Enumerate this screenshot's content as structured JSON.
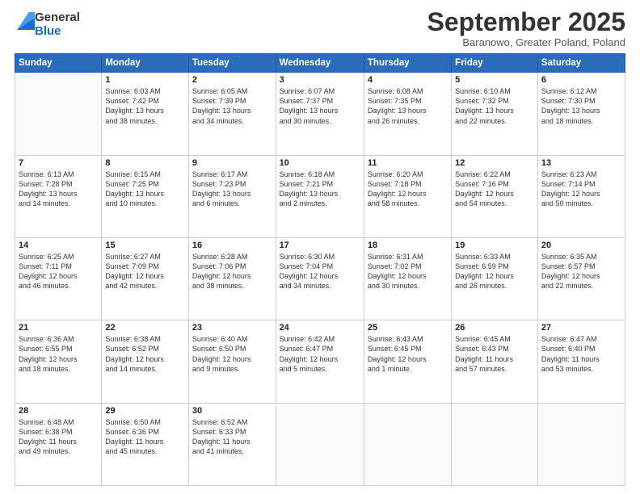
{
  "logo": {
    "general": "General",
    "blue": "Blue"
  },
  "header": {
    "month": "September 2025",
    "subtitle": "Baranowo, Greater Poland, Poland"
  },
  "weekdays": [
    "Sunday",
    "Monday",
    "Tuesday",
    "Wednesday",
    "Thursday",
    "Friday",
    "Saturday"
  ],
  "weeks": [
    [
      {
        "day": "",
        "info": ""
      },
      {
        "day": "1",
        "info": "Sunrise: 6:03 AM\nSunset: 7:42 PM\nDaylight: 13 hours\nand 38 minutes."
      },
      {
        "day": "2",
        "info": "Sunrise: 6:05 AM\nSunset: 7:39 PM\nDaylight: 13 hours\nand 34 minutes."
      },
      {
        "day": "3",
        "info": "Sunrise: 6:07 AM\nSunset: 7:37 PM\nDaylight: 13 hours\nand 30 minutes."
      },
      {
        "day": "4",
        "info": "Sunrise: 6:08 AM\nSunset: 7:35 PM\nDaylight: 13 hours\nand 26 minutes."
      },
      {
        "day": "5",
        "info": "Sunrise: 6:10 AM\nSunset: 7:32 PM\nDaylight: 13 hours\nand 22 minutes."
      },
      {
        "day": "6",
        "info": "Sunrise: 6:12 AM\nSunset: 7:30 PM\nDaylight: 13 hours\nand 18 minutes."
      }
    ],
    [
      {
        "day": "7",
        "info": "Sunrise: 6:13 AM\nSunset: 7:28 PM\nDaylight: 13 hours\nand 14 minutes."
      },
      {
        "day": "8",
        "info": "Sunrise: 6:15 AM\nSunset: 7:25 PM\nDaylight: 13 hours\nand 10 minutes."
      },
      {
        "day": "9",
        "info": "Sunrise: 6:17 AM\nSunset: 7:23 PM\nDaylight: 13 hours\nand 6 minutes."
      },
      {
        "day": "10",
        "info": "Sunrise: 6:18 AM\nSunset: 7:21 PM\nDaylight: 13 hours\nand 2 minutes."
      },
      {
        "day": "11",
        "info": "Sunrise: 6:20 AM\nSunset: 7:18 PM\nDaylight: 12 hours\nand 58 minutes."
      },
      {
        "day": "12",
        "info": "Sunrise: 6:22 AM\nSunset: 7:16 PM\nDaylight: 12 hours\nand 54 minutes."
      },
      {
        "day": "13",
        "info": "Sunrise: 6:23 AM\nSunset: 7:14 PM\nDaylight: 12 hours\nand 50 minutes."
      }
    ],
    [
      {
        "day": "14",
        "info": "Sunrise: 6:25 AM\nSunset: 7:11 PM\nDaylight: 12 hours\nand 46 minutes."
      },
      {
        "day": "15",
        "info": "Sunrise: 6:27 AM\nSunset: 7:09 PM\nDaylight: 12 hours\nand 42 minutes."
      },
      {
        "day": "16",
        "info": "Sunrise: 6:28 AM\nSunset: 7:06 PM\nDaylight: 12 hours\nand 38 minutes."
      },
      {
        "day": "17",
        "info": "Sunrise: 6:30 AM\nSunset: 7:04 PM\nDaylight: 12 hours\nand 34 minutes."
      },
      {
        "day": "18",
        "info": "Sunrise: 6:31 AM\nSunset: 7:02 PM\nDaylight: 12 hours\nand 30 minutes."
      },
      {
        "day": "19",
        "info": "Sunrise: 6:33 AM\nSunset: 6:59 PM\nDaylight: 12 hours\nand 26 minutes."
      },
      {
        "day": "20",
        "info": "Sunrise: 6:35 AM\nSunset: 6:57 PM\nDaylight: 12 hours\nand 22 minutes."
      }
    ],
    [
      {
        "day": "21",
        "info": "Sunrise: 6:36 AM\nSunset: 6:55 PM\nDaylight: 12 hours\nand 18 minutes."
      },
      {
        "day": "22",
        "info": "Sunrise: 6:38 AM\nSunset: 6:52 PM\nDaylight: 12 hours\nand 14 minutes."
      },
      {
        "day": "23",
        "info": "Sunrise: 6:40 AM\nSunset: 6:50 PM\nDaylight: 12 hours\nand 9 minutes."
      },
      {
        "day": "24",
        "info": "Sunrise: 6:42 AM\nSunset: 6:47 PM\nDaylight: 12 hours\nand 5 minutes."
      },
      {
        "day": "25",
        "info": "Sunrise: 6:43 AM\nSunset: 6:45 PM\nDaylight: 12 hours\nand 1 minute."
      },
      {
        "day": "26",
        "info": "Sunrise: 6:45 AM\nSunset: 6:43 PM\nDaylight: 11 hours\nand 57 minutes."
      },
      {
        "day": "27",
        "info": "Sunrise: 6:47 AM\nSunset: 6:40 PM\nDaylight: 11 hours\nand 53 minutes."
      }
    ],
    [
      {
        "day": "28",
        "info": "Sunrise: 6:48 AM\nSunset: 6:38 PM\nDaylight: 11 hours\nand 49 minutes."
      },
      {
        "day": "29",
        "info": "Sunrise: 6:50 AM\nSunset: 6:36 PM\nDaylight: 11 hours\nand 45 minutes."
      },
      {
        "day": "30",
        "info": "Sunrise: 6:52 AM\nSunset: 6:33 PM\nDaylight: 11 hours\nand 41 minutes."
      },
      {
        "day": "",
        "info": ""
      },
      {
        "day": "",
        "info": ""
      },
      {
        "day": "",
        "info": ""
      },
      {
        "day": "",
        "info": ""
      }
    ]
  ]
}
